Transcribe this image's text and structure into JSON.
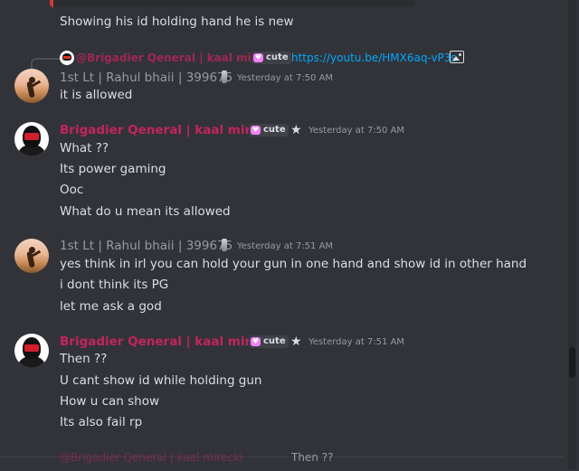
{
  "prev_message": {
    "text": "Showing his id holding hand he is new"
  },
  "reply": {
    "name": "@Brigadier Qeneral | kaal mirecki",
    "tag": "cute",
    "link": "https://youtu.be/HMX6aq-vP3s",
    "icon": "image-icon"
  },
  "messages": [
    {
      "author": "1st Lt  | Rahul bhaii | 399675",
      "timestamp": "Yesterday at 7:50 AM",
      "lines": [
        "it is allowed"
      ]
    },
    {
      "author": "Brigadier Qeneral | kaal mirecki",
      "tag": "cute",
      "timestamp": "Yesterday at 7:50 AM",
      "lines": [
        "What ??",
        "Its power gaming",
        "Ooc",
        "What do u mean its allowed"
      ]
    },
    {
      "author": "1st Lt  | Rahul bhaii | 399675",
      "timestamp": "Yesterday at 7:51 AM",
      "lines": [
        "yes think in irl you can hold your gun in one hand and show id in other hand",
        "i dont think its PG",
        "let me ask a god"
      ]
    },
    {
      "author": "Brigadier Qeneral | kaal mirecki",
      "tag": "cute",
      "timestamp": "Yesterday at 7:51 AM",
      "lines": [
        "Then ??",
        "U cant show id while holding gun",
        "How u can show",
        "Its also fail rp"
      ]
    }
  ],
  "next_peek": {
    "name": "@Brigadier Qeneral | kaal mirecki",
    "text": "Then ??"
  }
}
